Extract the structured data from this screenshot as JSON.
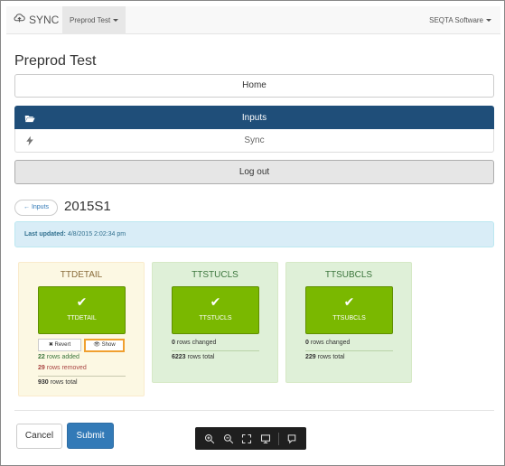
{
  "navbar": {
    "brand": "SYNC",
    "project": "Preprod Test",
    "account": "SEQTA Software"
  },
  "page_title": "Preprod Test",
  "home_label": "Home",
  "menu": {
    "inputs_label": "Inputs",
    "sync_label": "Sync"
  },
  "logout_label": "Log out",
  "back_label": "← Inputs",
  "batch_title": "2015S1",
  "last_updated": {
    "label": "Last updated:",
    "value": "4/8/2015 2:02:34 pm"
  },
  "cards": [
    {
      "title": "TTDETAIL",
      "tile_label": "TTDETAIL",
      "revert_label": "Revert",
      "show_label": "Show",
      "added_count": "22",
      "added_text": "rows added",
      "removed_count": "29",
      "removed_text": "rows removed",
      "total_count": "930",
      "total_text": "rows total"
    },
    {
      "title": "TTSTUCLS",
      "tile_label": "TTSTUCLS",
      "changed_count": "0",
      "changed_text": "rows changed",
      "total_count": "6223",
      "total_text": "rows total"
    },
    {
      "title": "TTSUBCLS",
      "tile_label": "TTSUBCLS",
      "changed_count": "0",
      "changed_text": "rows changed",
      "total_count": "229",
      "total_text": "rows total"
    }
  ],
  "cancel_label": "Cancel",
  "submit_label": "Submit",
  "colors": {
    "primary": "#337ab7",
    "active_menu": "#1f4e79",
    "success_tile": "#7ab800",
    "highlight": "#f0a030"
  },
  "icons": [
    "cloud-sync-icon",
    "folder-open-icon",
    "bolt-icon",
    "check-icon",
    "times-icon",
    "eye-icon",
    "zoom-in-icon",
    "zoom-out-icon",
    "fullscreen-icon",
    "monitor-icon",
    "comment-icon"
  ]
}
